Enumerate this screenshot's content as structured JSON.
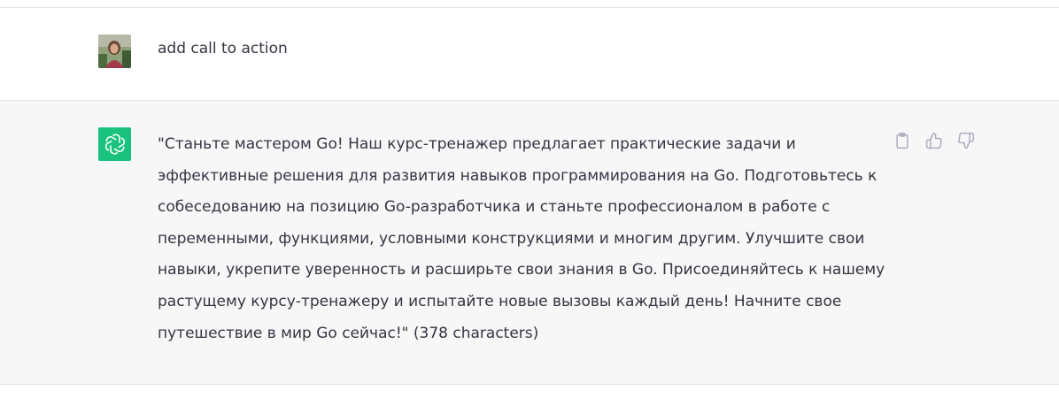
{
  "user_message": {
    "text": "add call to action",
    "avatar": "user-photo"
  },
  "assistant_message": {
    "logo": "openai-logo-icon",
    "text": "\"Станьте мастером Go! Наш курс-тренажер предлагает практические задачи и эффективные решения для развития навыков программирования на Go. Подготовьтесь к собеседованию на позицию Go-разработчика и станьте профессионалом в работе с переменными, функциями, условными конструкциями и многим другим. Улучшите свои навыки, укрепите уверенность и расширьте свои знания в Go. Присоединяйтесь к нашему растущему курсу-тренажеру и испытайте новые вызовы каждый день! Начните свое путешествие в мир Go сейчас!\" (378 characters)",
    "actions": [
      "copy-icon",
      "thumbs-up-icon",
      "thumbs-down-icon"
    ]
  },
  "colors": {
    "assistant_bg": "#f7f7f8",
    "logo_bg": "#19c37d",
    "text": "#343541",
    "icon": "#acacbe"
  }
}
